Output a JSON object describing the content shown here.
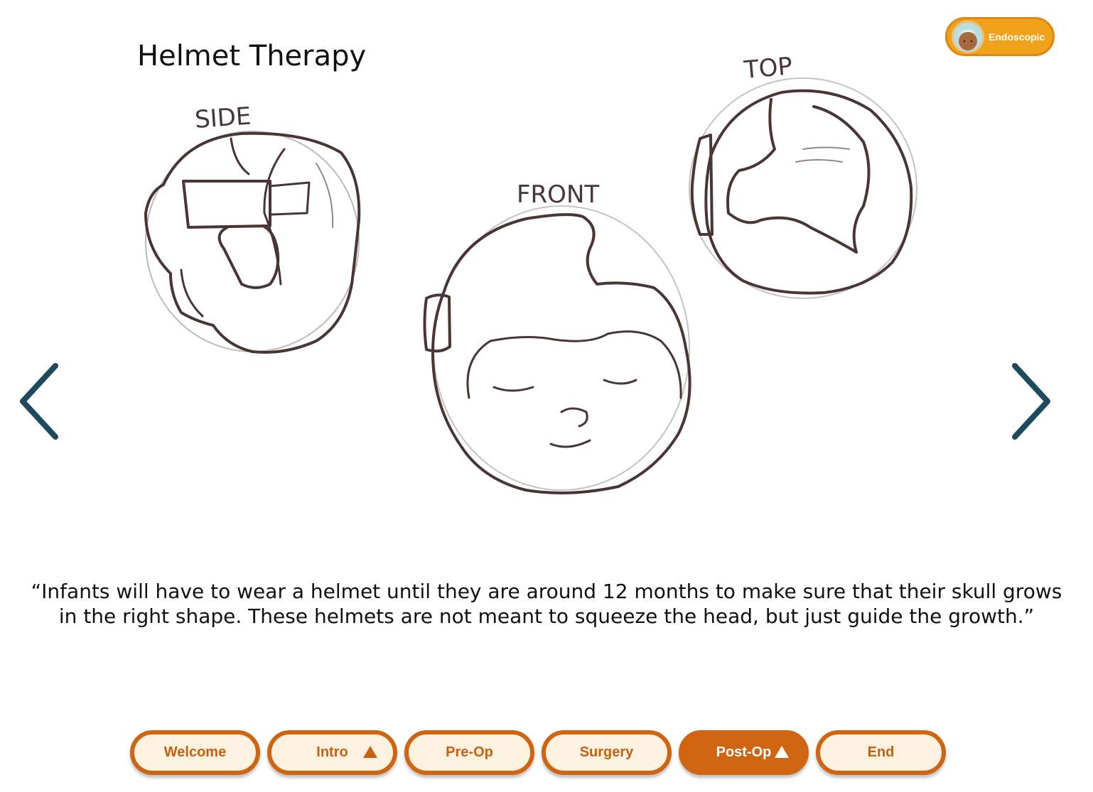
{
  "title": "Helmet Therapy",
  "badge": {
    "label": "Endoscopic"
  },
  "sketch_labels": {
    "side": "SIDE",
    "front": "FRONT",
    "top": "TOP"
  },
  "caption": "“Infants will have to wear a helmet until they are around 12 months to make sure that their skull grows in the right shape. These helmets are not meant to squeeze the head, but just guide the growth.”",
  "nav": {
    "items": [
      {
        "label": "Welcome",
        "dropdown": false,
        "active": false
      },
      {
        "label": "Intro",
        "dropdown": true,
        "active": false
      },
      {
        "label": "Pre-Op",
        "dropdown": false,
        "active": false
      },
      {
        "label": "Surgery",
        "dropdown": false,
        "active": false
      },
      {
        "label": "Post-Op",
        "dropdown": true,
        "active": true
      },
      {
        "label": "End",
        "dropdown": false,
        "active": false
      }
    ]
  },
  "colors": {
    "accent": "#cf6510",
    "pill_bg": "#fdf2df",
    "badge": "#f0a21b",
    "arrow": "#1d4a5c",
    "sketch": "#4a3535"
  }
}
